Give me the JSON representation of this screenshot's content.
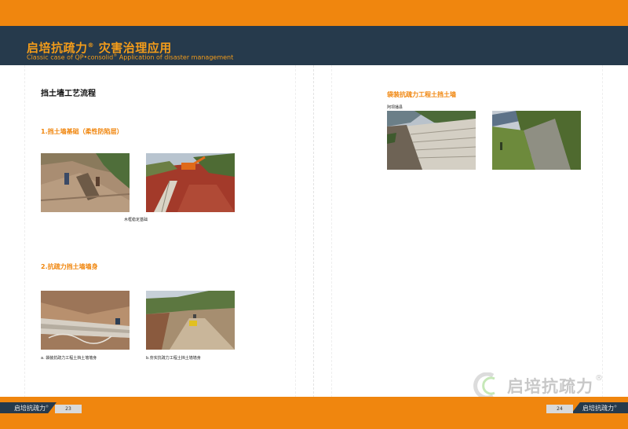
{
  "header": {
    "title": "启培抗疏力",
    "title_reg": "®",
    "title_rest": " 灾害治理应用",
    "subtitle_a": "Classic case of QP•consolid",
    "subtitle_reg": "®",
    "subtitle_b": " Application of disaster management"
  },
  "left_page": {
    "heading": "挡土墙工艺流程",
    "section1": "1.挡土墙基础（柔性防陷层）",
    "caption1": "木框稳定基础",
    "section2": "2.抗疏力挡土墙墙身",
    "caption2a": "a. 袋装抗疏力工程土挡土墙墙身",
    "caption2b": "b.夯实抗疏力工程土挡土墙墙身",
    "page_number": "23"
  },
  "right_page": {
    "section": "袋装抗疏力工程土挡土墙",
    "caption": "阿坝播县",
    "page_number": "24"
  },
  "footer": {
    "brand_left": "启培抗疏力",
    "brand_right": "启培抗疏力",
    "reg": "®"
  },
  "watermark": {
    "text": "启培抗疏力",
    "reg": "®"
  },
  "colors": {
    "orange": "#f0860e",
    "navy": "#263a4c"
  }
}
